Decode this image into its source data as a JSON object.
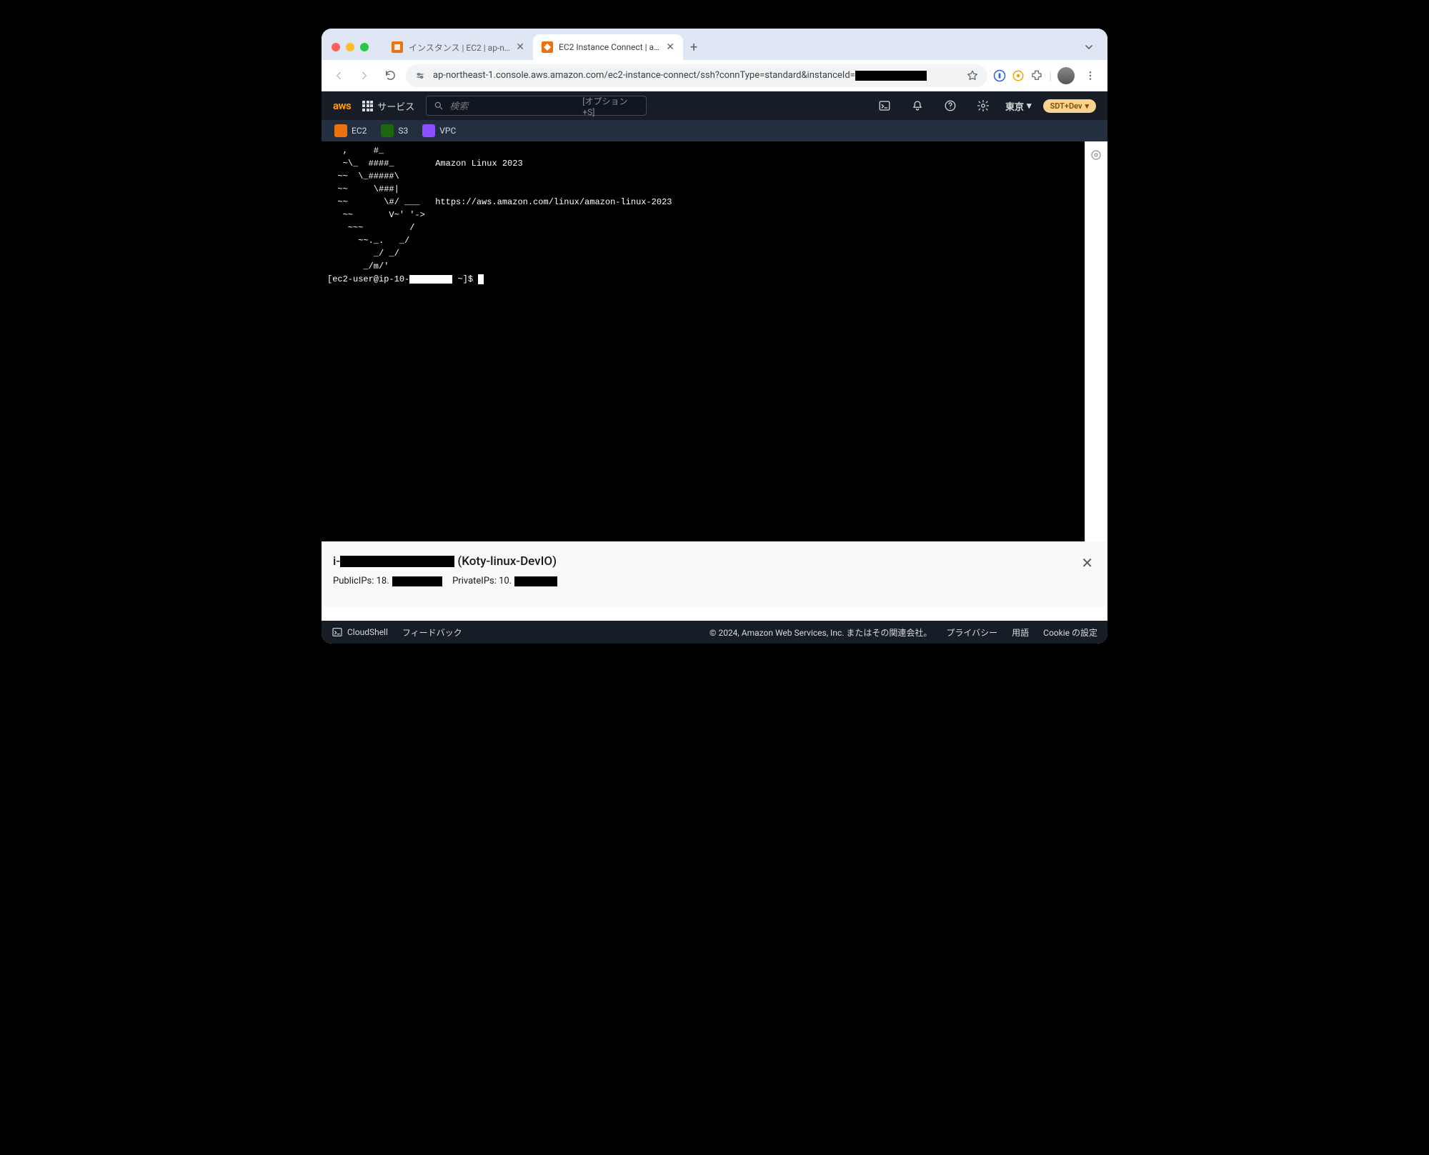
{
  "browser": {
    "tabs": [
      {
        "title": "インスタンス | EC2 | ap-northe",
        "active": false
      },
      {
        "title": "EC2 Instance Connect | ap-no",
        "active": true
      }
    ],
    "url": "ap-northeast-1.console.aws.amazon.com/ec2-instance-connect/ssh?connType=standard&instanceId="
  },
  "aws_nav": {
    "logo": "aws",
    "services_label": "サービス",
    "search_placeholder": "検索",
    "search_hint": "[オプション+S]",
    "region": "東京",
    "account_badge": "SDT+Dev"
  },
  "shortcuts": [
    {
      "label": "EC2",
      "color": "ec2"
    },
    {
      "label": "S3",
      "color": "s3"
    },
    {
      "label": "VPC",
      "color": "vpc"
    }
  ],
  "terminal": {
    "ascii": "   ,     #_\n   ~\\_  ####_        Amazon Linux 2023\n  ~~  \\_#####\\\n  ~~     \\###|\n  ~~       \\#/ ___   https://aws.amazon.com/linux/amazon-linux-2023\n   ~~       V~' '->\n    ~~~         /\n      ~~._.   _/\n         _/ _/\n       _/m/'",
    "prompt_prefix": "[ec2-user@ip-10-",
    "prompt_suffix": " ~]$ "
  },
  "info_panel": {
    "id_prefix": "i-",
    "name": "(Koty-linux-DevIO)",
    "public_label": "PublicIPs: 18.",
    "private_label": "PrivateIPs: 10."
  },
  "footer": {
    "cloudshell": "CloudShell",
    "feedback": "フィードバック",
    "copyright": "© 2024, Amazon Web Services, Inc. またはその関連会社。",
    "privacy": "プライバシー",
    "terms": "用語",
    "cookies": "Cookie の設定"
  }
}
